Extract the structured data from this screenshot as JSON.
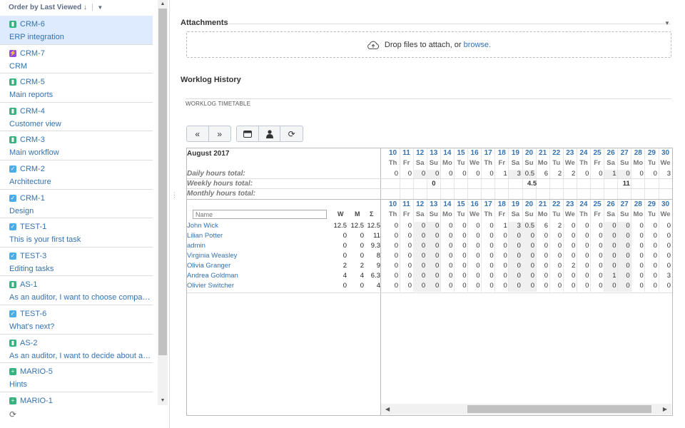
{
  "sidebar": {
    "order_label": "Order by Last Viewed",
    "issues": [
      {
        "key": "CRM-6",
        "summary": "ERP integration",
        "type": "story",
        "selected": true
      },
      {
        "key": "CRM-7",
        "summary": "CRM",
        "type": "epic"
      },
      {
        "key": "CRM-5",
        "summary": "Main reports",
        "type": "story"
      },
      {
        "key": "CRM-4",
        "summary": "Customer view",
        "type": "story"
      },
      {
        "key": "CRM-3",
        "summary": "Main workflow",
        "type": "story"
      },
      {
        "key": "CRM-2",
        "summary": "Architecture",
        "type": "task"
      },
      {
        "key": "CRM-1",
        "summary": "Design",
        "type": "task"
      },
      {
        "key": "TEST-1",
        "summary": "This is your first task",
        "type": "task"
      },
      {
        "key": "TEST-3",
        "summary": "Editing tasks",
        "type": "task"
      },
      {
        "key": "AS-1",
        "summary": "As an auditor, I want to choose company...",
        "type": "story"
      },
      {
        "key": "TEST-6",
        "summary": "What's next?",
        "type": "task"
      },
      {
        "key": "AS-2",
        "summary": "As an auditor, I want to decide about au...",
        "type": "story"
      },
      {
        "key": "MARIO-5",
        "summary": "Hints",
        "type": "new"
      },
      {
        "key": "MARIO-1",
        "summary": "",
        "type": "new"
      }
    ]
  },
  "attachments": {
    "title": "Attachments",
    "drop_text": "Drop files to attach, or",
    "browse_link": "browse."
  },
  "worklog": {
    "title": "Worklog History",
    "timetable_title": "WORKLOG TIMETABLE",
    "buttons": [
      "«",
      "»"
    ],
    "month": "August 2017",
    "daily_label": "Daily hours total:",
    "weekly_label": "Weekly hours total:",
    "monthly_label": "Monthly hours total:",
    "name_placeholder": "Name",
    "col_w": "W",
    "col_m": "M",
    "col_sum": "Σ",
    "days": [
      {
        "d": "10",
        "w": "Th",
        "total": "0"
      },
      {
        "d": "11",
        "w": "Fr",
        "total": "0"
      },
      {
        "d": "12",
        "w": "Sa",
        "total": "0",
        "we": true
      },
      {
        "d": "13",
        "w": "Su",
        "total": "0",
        "we": true
      },
      {
        "d": "14",
        "w": "Mo",
        "total": "0"
      },
      {
        "d": "15",
        "w": "Tu",
        "total": "0"
      },
      {
        "d": "16",
        "w": "We",
        "total": "0"
      },
      {
        "d": "17",
        "w": "Th",
        "total": "0"
      },
      {
        "d": "18",
        "w": "Fr",
        "total": "1"
      },
      {
        "d": "19",
        "w": "Sa",
        "total": "3",
        "we": true
      },
      {
        "d": "20",
        "w": "Su",
        "total": "0.5",
        "we": true
      },
      {
        "d": "21",
        "w": "Mo",
        "total": "6"
      },
      {
        "d": "22",
        "w": "Tu",
        "total": "2"
      },
      {
        "d": "23",
        "w": "We",
        "total": "2"
      },
      {
        "d": "24",
        "w": "Th",
        "total": "0"
      },
      {
        "d": "25",
        "w": "Fr",
        "total": "0"
      },
      {
        "d": "26",
        "w": "Sa",
        "total": "1",
        "we": true
      },
      {
        "d": "27",
        "w": "Su",
        "total": "0",
        "we": true
      },
      {
        "d": "28",
        "w": "Mo",
        "total": "0"
      },
      {
        "d": "29",
        "w": "Tu",
        "total": "0"
      },
      {
        "d": "30",
        "w": "We",
        "total": "3"
      }
    ],
    "weekly_totals": [
      {
        "day_index": 3,
        "value": "0"
      },
      {
        "day_index": 10,
        "value": "4.5"
      },
      {
        "day_index": 17,
        "value": "11"
      }
    ],
    "people": [
      {
        "name": "John Wick",
        "w": "12.5",
        "m": "12.5",
        "sum": "12.5",
        "vals": [
          "0",
          "0",
          "0",
          "0",
          "0",
          "0",
          "0",
          "0",
          "1",
          "3",
          "0.5",
          "6",
          "2",
          "0",
          "0",
          "0",
          "0",
          "0",
          "0",
          "0",
          "0"
        ]
      },
      {
        "name": "Lilian Potter",
        "w": "0",
        "m": "0",
        "sum": "11",
        "vals": [
          "0",
          "0",
          "0",
          "0",
          "0",
          "0",
          "0",
          "0",
          "0",
          "0",
          "0",
          "0",
          "0",
          "0",
          "0",
          "0",
          "0",
          "0",
          "0",
          "0",
          "0"
        ]
      },
      {
        "name": "admin",
        "w": "0",
        "m": "0",
        "sum": "9.3",
        "vals": [
          "0",
          "0",
          "0",
          "0",
          "0",
          "0",
          "0",
          "0",
          "0",
          "0",
          "0",
          "0",
          "0",
          "0",
          "0",
          "0",
          "0",
          "0",
          "0",
          "0",
          "0"
        ]
      },
      {
        "name": "Virginia Weasley",
        "w": "0",
        "m": "0",
        "sum": "8",
        "vals": [
          "0",
          "0",
          "0",
          "0",
          "0",
          "0",
          "0",
          "0",
          "0",
          "0",
          "0",
          "0",
          "0",
          "0",
          "0",
          "0",
          "0",
          "0",
          "0",
          "0",
          "0"
        ]
      },
      {
        "name": "Olivia Granger",
        "w": "2",
        "m": "2",
        "sum": "9",
        "vals": [
          "0",
          "0",
          "0",
          "0",
          "0",
          "0",
          "0",
          "0",
          "0",
          "0",
          "0",
          "0",
          "0",
          "2",
          "0",
          "0",
          "0",
          "0",
          "0",
          "0",
          "0"
        ]
      },
      {
        "name": "Andrea Goldman",
        "w": "4",
        "m": "4",
        "sum": "6.3",
        "vals": [
          "0",
          "0",
          "0",
          "0",
          "0",
          "0",
          "0",
          "0",
          "0",
          "0",
          "0",
          "0",
          "0",
          "0",
          "0",
          "0",
          "1",
          "0",
          "0",
          "0",
          "3"
        ]
      },
      {
        "name": "Olivier Switcher",
        "w": "0",
        "m": "0",
        "sum": "4",
        "vals": [
          "0",
          "0",
          "0",
          "0",
          "0",
          "0",
          "0",
          "0",
          "0",
          "0",
          "0",
          "0",
          "0",
          "0",
          "0",
          "0",
          "0",
          "0",
          "0",
          "0",
          "0"
        ]
      }
    ]
  }
}
